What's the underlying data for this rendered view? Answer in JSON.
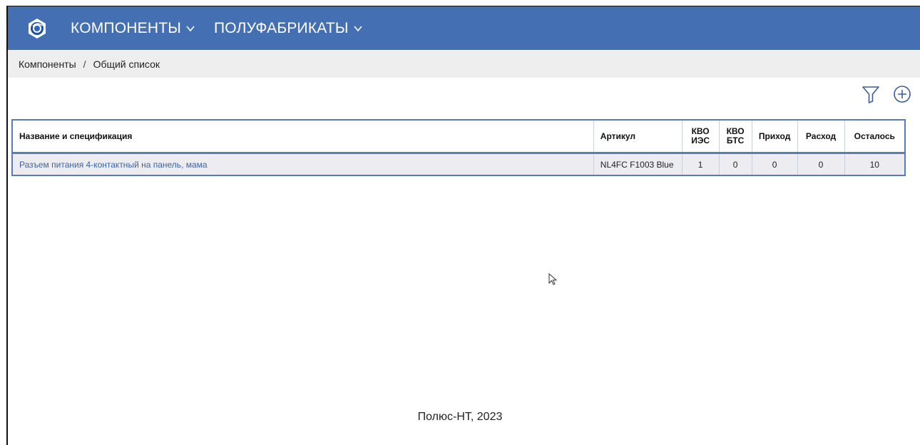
{
  "header": {
    "logo_icon": "app-logo-icon",
    "nav": [
      {
        "label": "КОМПОНЕНТЫ",
        "icon": "chevron-down-icon"
      },
      {
        "label": "ПОЛУФАБРИКАТЫ",
        "icon": "chevron-down-icon"
      }
    ],
    "color": "#4470b3"
  },
  "breadcrumb": {
    "items": [
      "Компоненты",
      "Общий список"
    ],
    "separator": "/"
  },
  "toolbar": {
    "filter_icon": "filter-icon",
    "add_icon": "add-circle-icon"
  },
  "table": {
    "columns": [
      "Название и спецификация",
      "Артикул",
      "КВО ИЭС",
      "КВО БТС",
      "Приход",
      "Расход",
      "Осталось"
    ],
    "rows": [
      {
        "name": "Разъем питания 4-контактный на панель, мама",
        "article": "NL4FC F1003 Blue",
        "kvo_ies": "1",
        "kvo_bts": "0",
        "income": "0",
        "expense": "0",
        "remaining": "10"
      }
    ]
  },
  "footer": {
    "text": "Полюс-НТ, 2023"
  }
}
